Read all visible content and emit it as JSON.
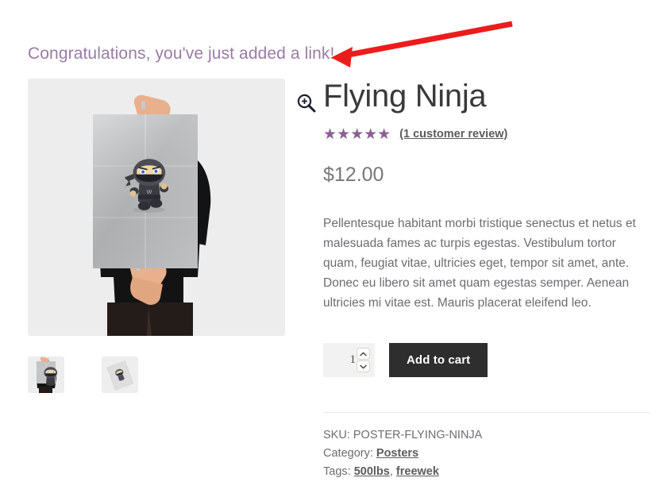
{
  "notice": {
    "message": "Congratulations, you've just added a link!"
  },
  "annotation": {
    "type": "arrow",
    "color": "#ed1c1c",
    "points_to": "notice-message"
  },
  "gallery": {
    "zoom_icon": "magnifier-plus-icon",
    "main_image_alt": "Person holding a Flying Ninja poster",
    "thumbnails": [
      {
        "alt": "Person holding Flying Ninja poster thumbnail"
      },
      {
        "alt": "Tilted Flying Ninja poster mockup thumbnail"
      }
    ]
  },
  "product": {
    "title": "Flying Ninja",
    "rating": {
      "stars": "★★★★★",
      "value": 5,
      "max": 5,
      "review_link": "(1 customer review)",
      "review_count": 1
    },
    "price": "$12.00",
    "description": "Pellentesque habitant morbi tristique senectus et netus et malesuada fames ac turpis egestas. Vestibulum tortor quam, feugiat vitae, ultricies eget, tempor sit amet, ante. Donec eu libero sit amet quam egestas semper. Aenean ultricies mi vitae est. Mauris placerat eleifend leo.",
    "cart": {
      "quantity_value": "1",
      "quantity_placeholder": "1",
      "increase_icon": "chevron-up-icon",
      "decrease_icon": "chevron-down-icon",
      "add_to_cart_label": "Add to cart"
    },
    "meta": {
      "sku_label": "SKU:",
      "sku_value": "POSTER-FLYING-NINJA",
      "category_label": "Category:",
      "category_value": "Posters",
      "tags_label": "Tags:",
      "tags": [
        "500lbs",
        "freewek"
      ],
      "tags_separator": ","
    }
  },
  "colors": {
    "notice_text": "#9a7ba6",
    "star": "#8c5f92",
    "price": "#77767a",
    "body_text": "#6d6c71",
    "button_bg": "#2e2e2e",
    "button_text": "#ffffff",
    "arrow": "#ed1c1c",
    "image_bg": "#ededed"
  }
}
